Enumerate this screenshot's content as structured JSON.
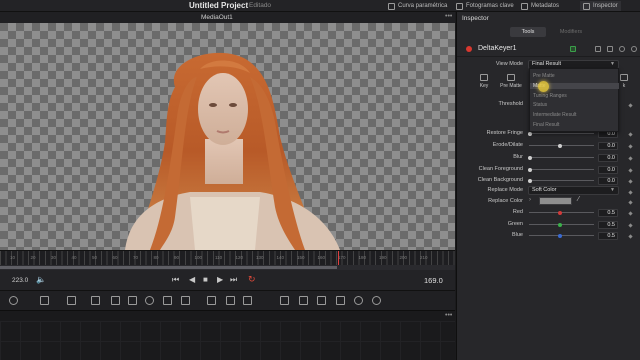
{
  "topbar": {
    "project_title": "Untitled Project",
    "project_status": "Editado",
    "buttons": [
      {
        "label": "Curva paramétrica",
        "icon": "curve-icon"
      },
      {
        "label": "Fotogramas clave",
        "icon": "keyframe-icon"
      },
      {
        "label": "Metadatos",
        "icon": "metadata-icon"
      },
      {
        "label": "Inspector",
        "icon": "inspector-icon",
        "active": true
      }
    ]
  },
  "viewer": {
    "name": "MediaOut1",
    "more": "•••"
  },
  "ruler": {
    "labels": [
      "10",
      "20",
      "30",
      "40",
      "50",
      "60",
      "70",
      "80",
      "90",
      "100",
      "110",
      "120",
      "130",
      "140",
      "150",
      "160",
      "170",
      "180",
      "190",
      "200",
      "210"
    ]
  },
  "transport": {
    "frame_in": "223.0",
    "frame_out": "169.0",
    "buttons": [
      "⏮",
      "◀",
      "■",
      "▶",
      "⏭"
    ],
    "loop": "↻",
    "audio": "🔈"
  },
  "nodes": {
    "more": "•••"
  },
  "inspector": {
    "title": "Inspector",
    "tabs": {
      "tools": "Tools",
      "modifiers": "Modifiers"
    },
    "node_name": "DeltaKeyer1",
    "view_mode_label": "View Mode",
    "view_mode_value": "Final Result",
    "view_mode_options": [
      "Pre Matte",
      "Matte",
      "Tuning Ranges",
      "Status",
      "Intermediate Result",
      "Final Result"
    ],
    "hover_option_index": 1,
    "mode_buttons": [
      "Key",
      "Pre Matte",
      "k"
    ],
    "threshold_label": "Threshold",
    "params": [
      {
        "label": "Restore Fringe",
        "value": "0.0",
        "level": 0.0
      },
      {
        "label": "Erode/Dilate",
        "value": "0.0",
        "level": 0.5
      },
      {
        "label": "Blur",
        "value": "0.0",
        "level": 0.0
      },
      {
        "label": "Clean Foreground",
        "value": "0.0",
        "level": 0.0
      },
      {
        "label": "Clean Background",
        "value": "0.0",
        "level": 0.0
      }
    ],
    "replace_mode_label": "Replace Mode",
    "replace_mode_value": "Soft Color",
    "replace_color_label": "Replace Color",
    "rgb": [
      {
        "label": "Red",
        "value": "0.5",
        "level": 0.5,
        "color": "#d23a3a"
      },
      {
        "label": "Green",
        "value": "0.5",
        "level": 0.5,
        "color": "#3ab04a"
      },
      {
        "label": "Blue",
        "value": "0.5",
        "level": 0.5,
        "color": "#3a6ad2"
      }
    ]
  }
}
